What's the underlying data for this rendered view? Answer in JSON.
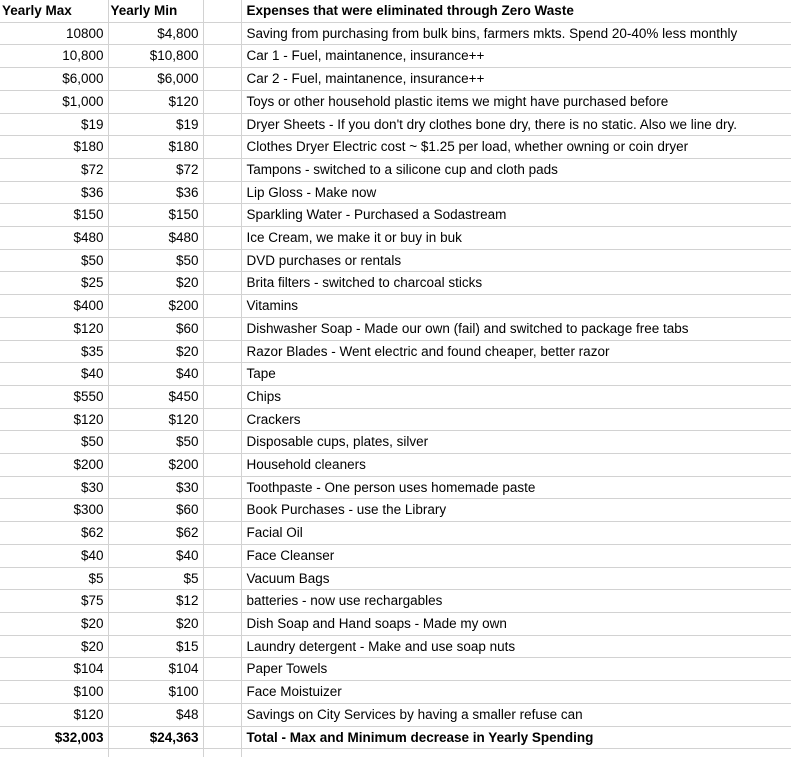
{
  "table": {
    "columns": {
      "yearly_max": "Yearly Max",
      "yearly_min": "Yearly Min",
      "spacer": "",
      "description": "Expenses that were eliminated through Zero Waste"
    },
    "rows": [
      {
        "max": "10800",
        "min": "$4,800",
        "desc": "Saving from purchasing from bulk bins, farmers mkts. Spend 20-40% less monthly"
      },
      {
        "max": "10,800",
        "min": "$10,800",
        "desc": "Car 1 - Fuel, maintanence, insurance++"
      },
      {
        "max": "$6,000",
        "min": "$6,000",
        "desc": "Car 2 - Fuel, maintanence, insurance++"
      },
      {
        "max": "$1,000",
        "min": "$120",
        "desc": "Toys or other household plastic items we might have purchased before"
      },
      {
        "max": "$19",
        "min": "$19",
        "desc": "Dryer Sheets - If you don't dry clothes bone dry, there is no static. Also we line dry."
      },
      {
        "max": "$180",
        "min": "$180",
        "desc": "Clothes Dryer Electric cost ~ $1.25 per load, whether owning or coin dryer"
      },
      {
        "max": "$72",
        "min": "$72",
        "desc": "Tampons - switched to a silicone cup and cloth pads"
      },
      {
        "max": "$36",
        "min": "$36",
        "desc": "Lip Gloss - Make now"
      },
      {
        "max": "$150",
        "min": "$150",
        "desc": "Sparkling Water - Purchased a Sodastream"
      },
      {
        "max": "$480",
        "min": "$480",
        "desc": "Ice Cream, we make it or buy in buk"
      },
      {
        "max": "$50",
        "min": "$50",
        "desc": "DVD purchases or rentals"
      },
      {
        "max": "$25",
        "min": "$20",
        "desc": "Brita filters - switched to charcoal sticks"
      },
      {
        "max": "$400",
        "min": "$200",
        "desc": "Vitamins"
      },
      {
        "max": "$120",
        "min": "$60",
        "desc": "Dishwasher Soap - Made our own (fail) and switched to package free tabs"
      },
      {
        "max": "$35",
        "min": "$20",
        "desc": "Razor Blades - Went electric and found cheaper, better razor"
      },
      {
        "max": "$40",
        "min": "$40",
        "desc": "Tape"
      },
      {
        "max": "$550",
        "min": "$450",
        "desc": "Chips"
      },
      {
        "max": "$120",
        "min": "$120",
        "desc": "Crackers"
      },
      {
        "max": "$50",
        "min": "$50",
        "desc": "Disposable cups, plates, silver"
      },
      {
        "max": "$200",
        "min": "$200",
        "desc": "Household cleaners"
      },
      {
        "max": "$30",
        "min": "$30",
        "desc": "Toothpaste - One person uses homemade paste"
      },
      {
        "max": "$300",
        "min": "$60",
        "desc": "Book Purchases - use the Library"
      },
      {
        "max": "$62",
        "min": "$62",
        "desc": "Facial Oil"
      },
      {
        "max": "$40",
        "min": "$40",
        "desc": "Face Cleanser"
      },
      {
        "max": "$5",
        "min": "$5",
        "desc": "Vacuum Bags"
      },
      {
        "max": "$75",
        "min": "$12",
        "desc": "batteries - now use rechargables"
      },
      {
        "max": "$20",
        "min": "$20",
        "desc": "Dish Soap and Hand soaps - Made my own"
      },
      {
        "max": "$20",
        "min": "$15",
        "desc": "Laundry detergent - Make and use soap nuts"
      },
      {
        "max": "$104",
        "min": "$104",
        "desc": "Paper Towels"
      },
      {
        "max": "$100",
        "min": "$100",
        "desc": "Face Moistuizer"
      },
      {
        "max": "$120",
        "min": "$48",
        "desc": "Savings on City Services by having a smaller refuse can"
      }
    ],
    "total_row": {
      "max": "$32,003",
      "min": "$24,363",
      "desc": "Total - Max and Minimum decrease in Yearly Spending"
    }
  },
  "colors": {
    "gridline": "#d2d2d2",
    "text": "#000000",
    "background": "#ffffff"
  }
}
